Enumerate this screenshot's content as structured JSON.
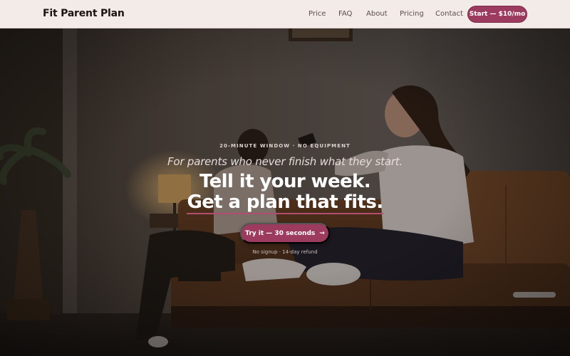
{
  "header": {
    "logo": "Fit Parent Plan",
    "nav": [
      "Price",
      "FAQ",
      "About",
      "Pricing",
      "Contact"
    ],
    "cta": "Start — $10/mo"
  },
  "hero": {
    "eyebrow": "20-MINUTE WINDOW · NO EQUIPMENT",
    "subhead": "For parents who never finish what they start.",
    "headline_line1": "Tell it your week.",
    "headline_line2": "Get a plan that fits.",
    "button_label": "Try it — 30 seconds",
    "button_icon": "arrow-right-icon",
    "note": "No signup · 14-day refund"
  },
  "colors": {
    "accent": "#9c3b5d",
    "header_bg": "#f3ebe8",
    "underline": "#b24d71"
  }
}
